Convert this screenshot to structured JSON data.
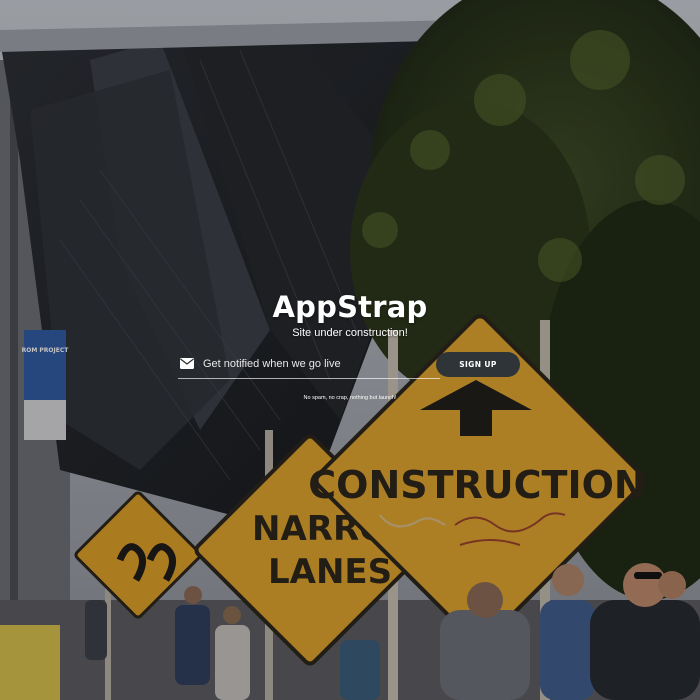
{
  "hero": {
    "title": "AppStrap",
    "subtitle": "Site under construction!"
  },
  "signup": {
    "email_placeholder": "Get notified when we go live",
    "email_value": "",
    "button_label": "SIGN UP",
    "icon": "envelope-icon",
    "disclaimer": "No spam, no crap, nothing but launch!"
  },
  "background": {
    "description_icon": "construction-photo",
    "signs": {
      "main": "CONSTRUCTION",
      "lanes_line1": "NARRO",
      "lanes_line2": "LANES"
    },
    "banner_text": "ROM PROJECT"
  },
  "colors": {
    "sign_yellow": "#e0a025",
    "button_bg": "#2f3439",
    "text": "#ffffff"
  }
}
